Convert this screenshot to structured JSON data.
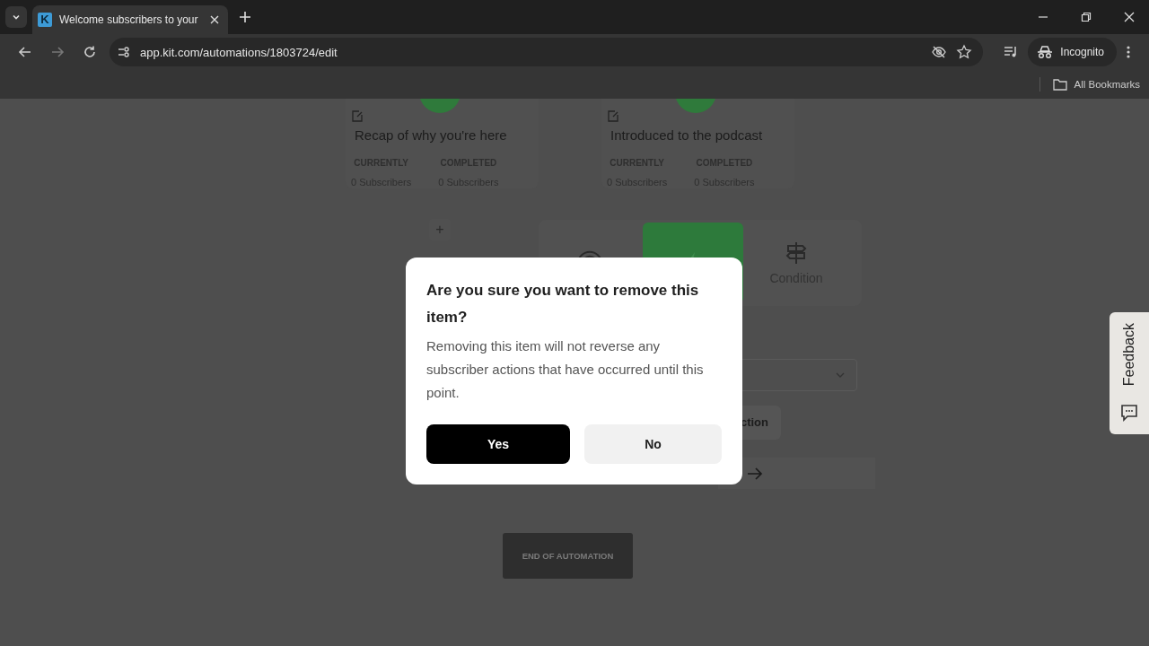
{
  "browser": {
    "tabs": [
      {
        "title": "Welcome subscribers to your",
        "favicon": "K",
        "selected": true
      }
    ],
    "url": "app.kit.com/automations/1803724/edit",
    "profile": "Incognito",
    "bookmarks": "All Bookmarks"
  },
  "canvas": {
    "steps": [
      {
        "title": "Recap of why you're here",
        "stats": [
          {
            "label": "CURRENTLY",
            "value": "0 Subscribers"
          },
          {
            "label": "COMPLETED",
            "value": "0 Subscribers"
          }
        ]
      },
      {
        "title": "Introduced to the podcast",
        "stats": [
          {
            "label": "CURRENTLY",
            "value": "0 Subscribers"
          },
          {
            "label": "COMPLETED",
            "value": "0 Subscribers"
          }
        ]
      }
    ],
    "add": "+",
    "picker": [
      {
        "kind": "event",
        "selected": false
      },
      {
        "kind": "action",
        "selected": true
      },
      {
        "kind": "condition",
        "label": "Condition",
        "selected": false
      }
    ],
    "partial_button": "ction",
    "end": "END OF AUTOMATION"
  },
  "dialog": {
    "title": "Are you sure you want to remove this item?",
    "message": "Removing this item will not reverse any subscriber actions that have occurred until this point.",
    "buttons": [
      {
        "label": "Yes",
        "kind": "primary"
      },
      {
        "label": "No",
        "kind": "secondary"
      }
    ]
  },
  "feedback": "Feedback"
}
